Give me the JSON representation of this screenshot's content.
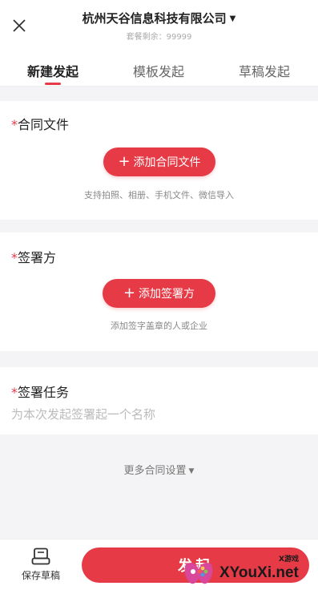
{
  "header": {
    "company_name": "杭州天谷信息科技有限公司",
    "quota_text": "套餐剩余：99999"
  },
  "tabs": [
    {
      "label": "新建发起"
    },
    {
      "label": "模板发起"
    },
    {
      "label": "草稿发起"
    }
  ],
  "contract_section": {
    "required_mark": "*",
    "title": "合同文件",
    "button_label": "添加合同文件",
    "hint": "支持拍照、相册、手机文件、微信导入"
  },
  "signer_section": {
    "required_mark": "*",
    "title": "签署方",
    "button_label": "添加签署方",
    "hint": "添加签字盖章的人或企业"
  },
  "task_section": {
    "required_mark": "*",
    "title": "签署任务",
    "placeholder": "为本次发起签署起一个名称",
    "value": ""
  },
  "more_settings": {
    "label": "更多合同设置"
  },
  "bottom_bar": {
    "draft_label": "保存草稿",
    "launch_label": "发起"
  },
  "watermark": {
    "text": "XYouXi.net",
    "small_text": "X游戏"
  },
  "colors": {
    "accent": "#e63a46",
    "background": "#f4f4f6"
  }
}
